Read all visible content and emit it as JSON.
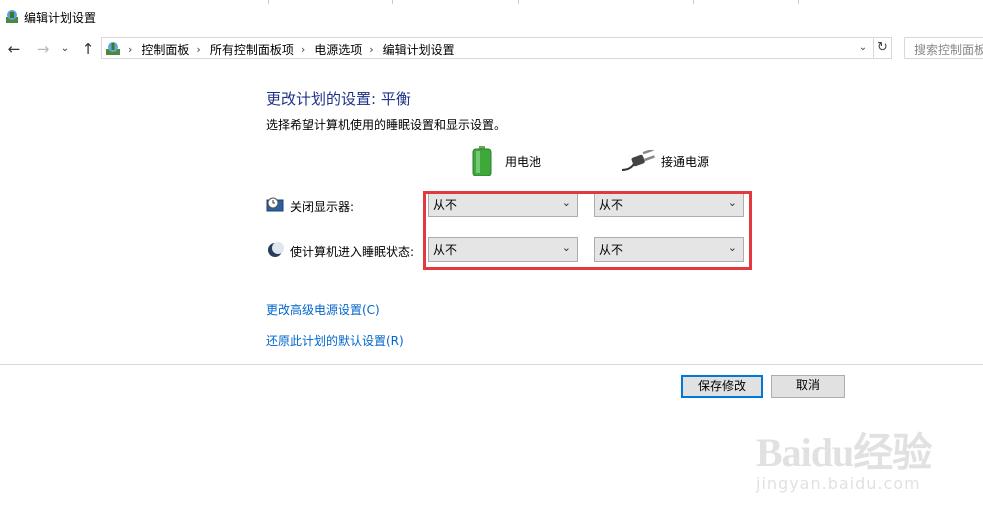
{
  "window": {
    "title": "编辑计划设置"
  },
  "address_bar": {
    "breadcrumbs": [
      "控制面板",
      "所有控制面板项",
      "电源选项",
      "编辑计划设置"
    ],
    "search_placeholder": "搜索控制面板"
  },
  "main": {
    "heading": "更改计划的设置: 平衡",
    "subtitle": "选择希望计算机使用的睡眠设置和显示设置。",
    "columns": {
      "battery": "用电池",
      "plugged_in": "接通电源"
    },
    "rows": [
      {
        "label": "关闭显示器:",
        "battery_value": "从不",
        "plugged_value": "从不"
      },
      {
        "label": "使计算机进入睡眠状态:",
        "battery_value": "从不",
        "plugged_value": "从不"
      }
    ],
    "links": {
      "advanced": "更改高级电源设置(C)",
      "restore": "还原此计划的默认设置(R)"
    }
  },
  "buttons": {
    "save": "保存修改",
    "cancel": "取消"
  },
  "watermark": {
    "text": "Baidu经验",
    "url": "jingyan.baidu.com"
  },
  "colors": {
    "heading": "#1e3287",
    "link": "#0066cc",
    "highlight": "#e2393f",
    "focus": "#0078d7"
  }
}
